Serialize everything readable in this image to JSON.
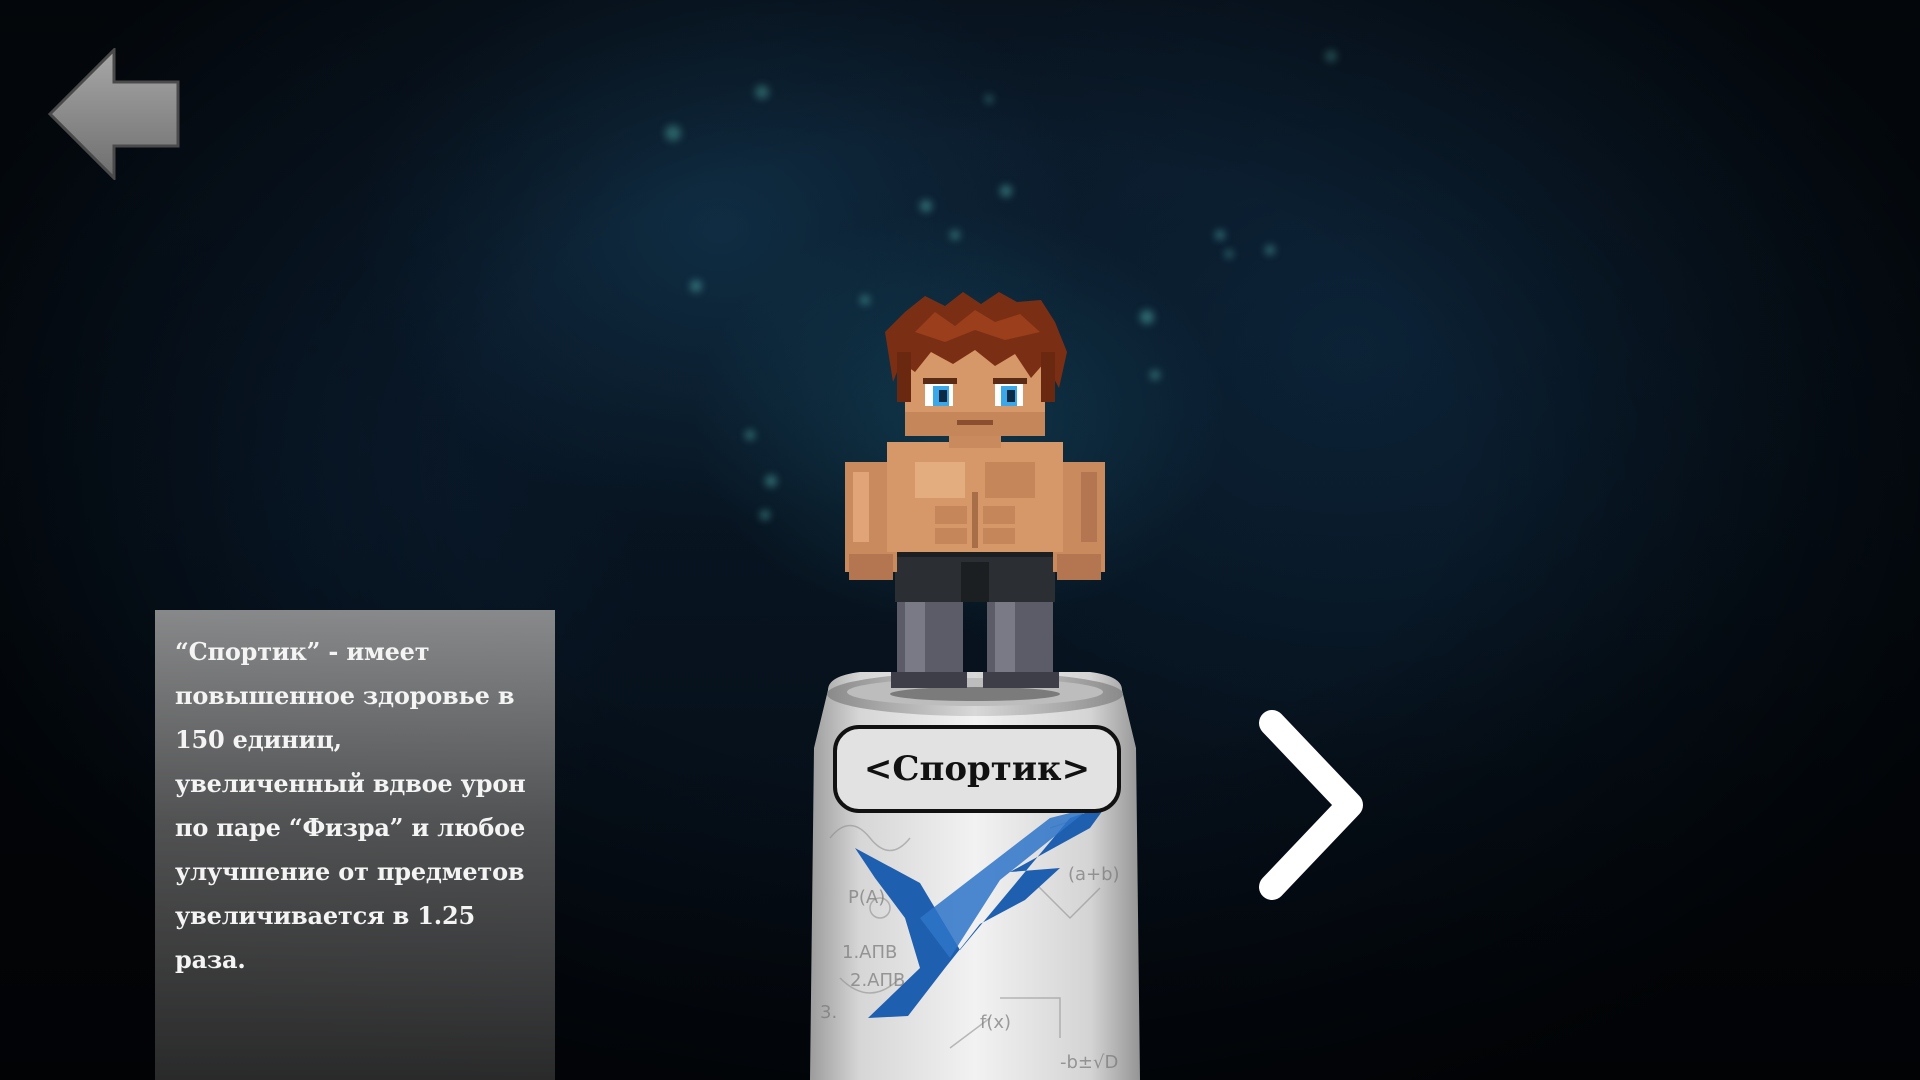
{
  "background": {
    "theme": "dark-blue-cave",
    "glow_color": "#5ac8be"
  },
  "navigation": {
    "back_icon": "left-arrow-icon",
    "next_icon": "chevron-right-icon"
  },
  "character": {
    "name": "<Спортик>",
    "description": "“Спортик” - имеет повышенное здоровье в 150 единиц, увеличенный вдвое урон по паре “Физра” и любое улучшение от предметов увеличивается в 1.25 раза."
  },
  "can": {
    "logo_color": "#1f5fb0",
    "formulas": [
      "P(A)",
      "1.AПB",
      "2.AПB",
      "(a+b)",
      "-b±√D",
      "f(x)",
      "3."
    ]
  }
}
